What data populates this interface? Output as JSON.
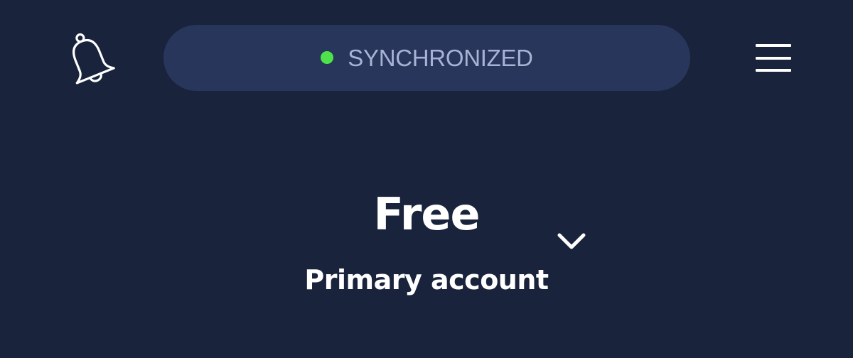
{
  "header": {
    "notifications_icon": "bell-icon",
    "sync_status": {
      "label": "SYNCHRONIZED",
      "dot_color": "#4ee34a"
    },
    "menu_icon": "hamburger-menu-icon"
  },
  "account": {
    "plan": "Free",
    "label": "Primary account",
    "dropdown_icon": "chevron-down-icon"
  },
  "colors": {
    "background": "#1a233c",
    "pill": "#27365a",
    "pill_text": "#a7b3d4",
    "foreground": "#ffffff"
  }
}
